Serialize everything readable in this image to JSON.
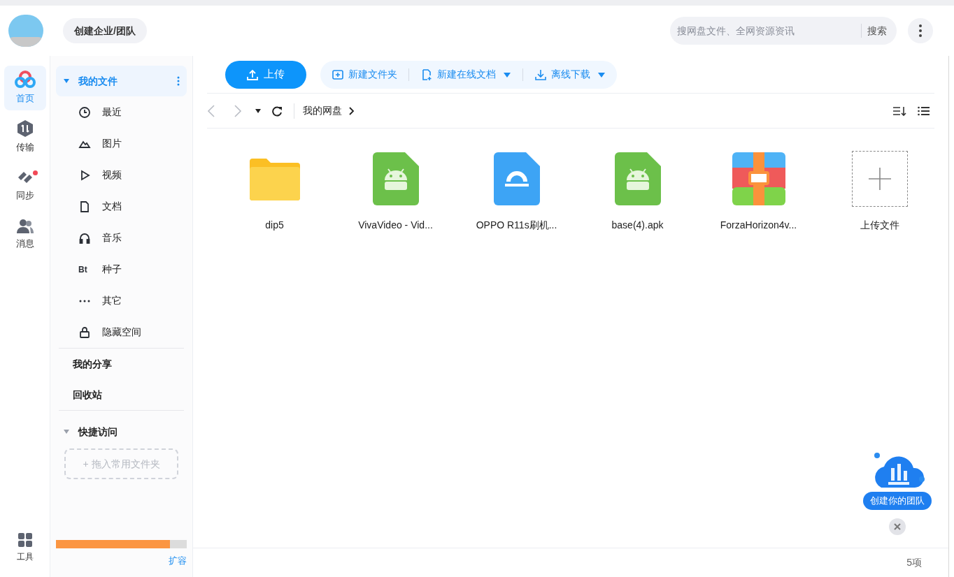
{
  "header": {
    "team_button": "创建企业/团队",
    "search": {
      "placeholder": "搜网盘文件、全网资源资讯",
      "button": "搜索"
    }
  },
  "nav": [
    {
      "label": "首页",
      "kind": "home",
      "selected": true,
      "badge": false
    },
    {
      "label": "传输",
      "kind": "transfer",
      "selected": false,
      "badge": false
    },
    {
      "label": "同步",
      "kind": "sync",
      "selected": false,
      "badge": true
    },
    {
      "label": "消息",
      "kind": "message",
      "selected": false,
      "badge": false
    }
  ],
  "nav_bottom": {
    "label": "工具"
  },
  "sidebar": {
    "my_files": {
      "label": "我的文件",
      "expanded": true,
      "selected": true
    },
    "items": [
      {
        "label": "最近",
        "kind": "clock"
      },
      {
        "label": "图片",
        "kind": "image"
      },
      {
        "label": "视频",
        "kind": "video"
      },
      {
        "label": "文档",
        "kind": "doc"
      },
      {
        "label": "音乐",
        "kind": "music"
      },
      {
        "label": "种子",
        "kind": "bt",
        "glyph": "Bt"
      },
      {
        "label": "其它",
        "kind": "more"
      },
      {
        "label": "隐藏空间",
        "kind": "lock"
      }
    ],
    "links": [
      "我的分享",
      "回收站"
    ],
    "quick_access": {
      "label": "快捷访问",
      "expanded": true,
      "drop_hint": "+ 拖入常用文件夹"
    },
    "storage": {
      "level": 0.87,
      "expand": "扩容"
    }
  },
  "toolbar": {
    "upload": "上传",
    "actions": [
      {
        "label": "新建文件夹",
        "kind": "folder-plus",
        "dropdown": false
      },
      {
        "label": "新建在线文档",
        "kind": "doc-plus",
        "dropdown": true
      },
      {
        "label": "离线下载",
        "kind": "download",
        "dropdown": true
      }
    ]
  },
  "breadcrumb": [
    "我的网盘"
  ],
  "files": [
    {
      "name": "dip5",
      "kind": "folder"
    },
    {
      "name": "VivaVideo - Vid...",
      "kind": "apk"
    },
    {
      "name": "OPPO R11s刷机...",
      "kind": "flash"
    },
    {
      "name": "base(4).apk",
      "kind": "apk"
    },
    {
      "name": "ForzaHorizon4v...",
      "kind": "archive"
    },
    {
      "name": "上传文件",
      "kind": "upload"
    }
  ],
  "promo": {
    "label": "创建你的团队"
  },
  "status": {
    "count": "5项"
  }
}
